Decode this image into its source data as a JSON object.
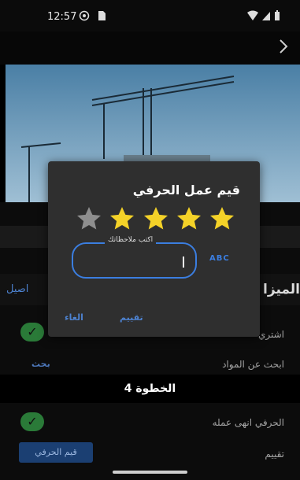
{
  "status_bar": {
    "time": "12:57"
  },
  "toolbar": {
    "forward_icon": "chevron-right-icon"
  },
  "background": {
    "section_title_partial": "الميزا",
    "details_tab_partial": "اصيل",
    "buy_row_partial": "اشتري",
    "search_materials_row": "ابحث عن المواد",
    "search_button": "بحث",
    "step_header": "الخطوة 4",
    "finished_row": "الحرفي انهى عمله",
    "rating_row": "تقييم",
    "rate_craftsman_button": "قيم الحرفي"
  },
  "dialog": {
    "title": "قيم عمل الحرفي",
    "rating": 4,
    "max_rating": 5,
    "notes_label": "اكتب ملاحظاتك",
    "notes_value": "",
    "keyboard_hint": "ABC",
    "rate_button": "تقييم",
    "cancel_button": "الغاء"
  },
  "colors": {
    "accent": "#3b7ee0",
    "star_on": "#f4d228",
    "star_off": "#8e8e8e",
    "check_green": "#2a7a38"
  }
}
